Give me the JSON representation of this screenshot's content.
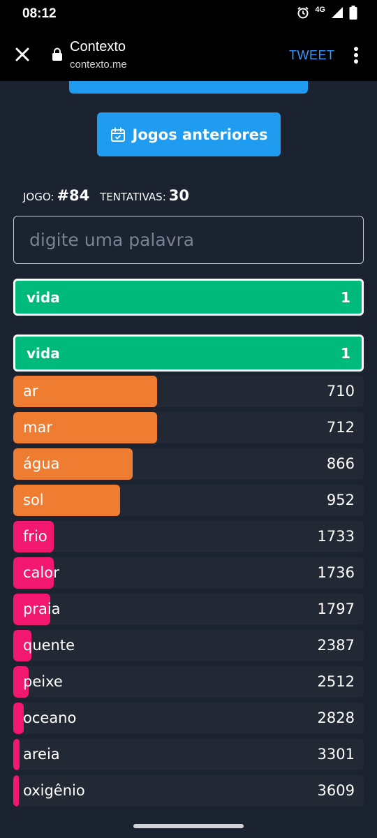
{
  "status_bar": {
    "time": "08:12",
    "network": "4G"
  },
  "browser": {
    "title": "Contexto",
    "url": "contexto.me",
    "action": "TWEET"
  },
  "page": {
    "previous_games_label": "Jogos anteriores",
    "game_label": "JOGO:",
    "game_number": "#84",
    "attempts_label": "TENTATIVAS:",
    "attempts": "30",
    "input_placeholder": "digite uma palavra",
    "last_guess": {
      "word": "vida",
      "rank": "1"
    },
    "best_guess": {
      "word": "vida",
      "rank": "1"
    },
    "guesses": [
      {
        "word": "ar",
        "rank": "710",
        "color": "#ef7d31",
        "fill": 0.41
      },
      {
        "word": "mar",
        "rank": "712",
        "color": "#ef7d31",
        "fill": 0.41
      },
      {
        "word": "água",
        "rank": "866",
        "color": "#ef7d31",
        "fill": 0.34
      },
      {
        "word": "sol",
        "rank": "952",
        "color": "#ef7d31",
        "fill": 0.305
      },
      {
        "word": "frio",
        "rank": "1733",
        "color": "#f2176f",
        "fill": 0.115
      },
      {
        "word": "calor",
        "rank": "1736",
        "color": "#f2176f",
        "fill": 0.115
      },
      {
        "word": "praia",
        "rank": "1797",
        "color": "#f2176f",
        "fill": 0.106
      },
      {
        "word": "quente",
        "rank": "2387",
        "color": "#f2176f",
        "fill": 0.052
      },
      {
        "word": "peixe",
        "rank": "2512",
        "color": "#f2176f",
        "fill": 0.044
      },
      {
        "word": "oceano",
        "rank": "2828",
        "color": "#f2176f",
        "fill": 0.03
      },
      {
        "word": "areia",
        "rank": "3301",
        "color": "#f2176f",
        "fill": 0.018
      },
      {
        "word": "oxigênio",
        "rank": "3609",
        "color": "#f2176f",
        "fill": 0.014
      }
    ]
  },
  "colors": {
    "accent": "#1f9bf0",
    "correct": "#00ba7c",
    "near": "#ef7d31",
    "far": "#f2176f"
  }
}
